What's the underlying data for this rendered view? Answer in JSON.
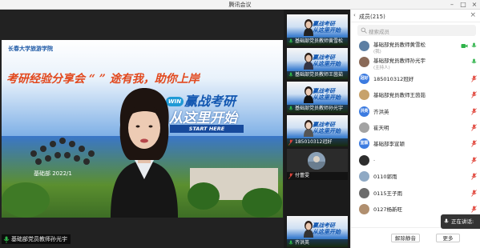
{
  "window": {
    "title": "腾讯会议"
  },
  "main": {
    "slide": {
      "school": "长春大学旅游学院",
      "banner": "考研经验分享会 “ ” 途有我，助你上岸",
      "win_badge": "WIN",
      "headline_1": "赢战考研",
      "headline_2": "从这里开始",
      "start_here": "START HERE",
      "dept": "基础部 2022/1"
    },
    "speaker_label": "基础部党员教师孙光宇"
  },
  "thumbnails": [
    {
      "label": "基础部党员教师黄雪松",
      "muted": false,
      "kind": "slide"
    },
    {
      "label": "基础部党员教师王茵茹",
      "muted": false,
      "kind": "slide"
    },
    {
      "label": "基础部党员教师孙光宇",
      "muted": false,
      "kind": "slide"
    },
    {
      "label": "185010312冠好",
      "muted": true,
      "kind": "slide"
    },
    {
      "label": "付蕾雯",
      "muted": true,
      "kind": "avatar"
    },
    {
      "label": "齐洪英",
      "muted": false,
      "kind": "slide"
    }
  ],
  "panel": {
    "title": "成员(215)",
    "search_placeholder": "搜索成员",
    "members": [
      {
        "name": "基础部党员教师黄雪松",
        "sub": "(我)",
        "avatar_text": "",
        "avatar_color": "#5d7fa3",
        "mic": "green",
        "video": true
      },
      {
        "name": "基础部党员教师孙光宇",
        "sub": "(主持人)",
        "avatar_text": "",
        "avatar_color": "#8a6a58",
        "mic": "green",
        "video": false
      },
      {
        "name": "185010312冠好",
        "sub": "",
        "avatar_text": "冠好",
        "avatar_color": "#3c7be0",
        "mic": "red",
        "video": false
      },
      {
        "name": "基础部党员教师王茵茹",
        "sub": "",
        "avatar_text": "",
        "avatar_color": "#c7a26b",
        "mic": "red",
        "video": false
      },
      {
        "name": "齐洪英",
        "sub": "",
        "avatar_text": "洪英",
        "avatar_color": "#3c7be0",
        "mic": "red",
        "video": false
      },
      {
        "name": "崔天明",
        "sub": "",
        "avatar_text": "",
        "avatar_color": "#a3a3a3",
        "mic": "red",
        "video": false
      },
      {
        "name": "基础部李宣颖",
        "sub": "",
        "avatar_text": "宣颖",
        "avatar_color": "#3c7be0",
        "mic": "red",
        "video": false
      },
      {
        "name": ".",
        "sub": "",
        "avatar_text": "",
        "avatar_color": "#2d2d2d",
        "mic": "red",
        "video": false
      },
      {
        "name": "0110郭雨",
        "sub": "",
        "avatar_text": "",
        "avatar_color": "#8fa9c4",
        "mic": "red",
        "video": false
      },
      {
        "name": "0115王子雨",
        "sub": "",
        "avatar_text": "",
        "avatar_color": "#6b6b6b",
        "mic": "red",
        "video": false
      },
      {
        "name": "0127杨新旺",
        "sub": "",
        "avatar_text": "",
        "avatar_color": "#b08f6f",
        "mic": "red",
        "video": false
      }
    ],
    "unmute_all": "解除静音",
    "more": "更多"
  },
  "toast": {
    "text": "正在讲话:"
  },
  "colors": {
    "accent_blue": "#3c7be0",
    "mic_green": "#2fb34a",
    "mic_red": "#e0463c"
  }
}
